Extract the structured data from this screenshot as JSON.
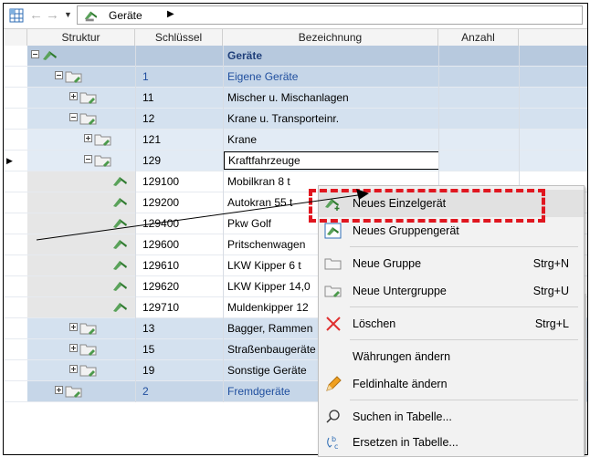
{
  "toolbar": {
    "grid_icon": "grid-icon",
    "back_icon": "arrow-left-icon",
    "forward_icon": "arrow-right-icon",
    "dropdown_icon": "triangle-down-icon",
    "breadcrumb": "Geräte",
    "breadcrumb_arrow": "▶",
    "back_glyph": "←",
    "forward_glyph": "→",
    "dropdown_glyph": "▼"
  },
  "columns": [
    "Struktur",
    "Schlüssel",
    "Bezeichnung",
    "Anzahl"
  ],
  "selected_row_indicator": "▶",
  "rows": [
    {
      "key": "",
      "name": "Geräte"
    },
    {
      "key": "1",
      "name": "Eigene Geräte"
    },
    {
      "key": "11",
      "name": "Mischer u. Mischanlagen"
    },
    {
      "key": "12",
      "name": "Krane u. Transporteinr."
    },
    {
      "key": "121",
      "name": "Krane"
    },
    {
      "key": "129",
      "name": "Kraftfahrzeuge"
    },
    {
      "key": "129100",
      "name": "Mobilkran 8 t"
    },
    {
      "key": "129200",
      "name": "Autokran 55 t"
    },
    {
      "key": "129400",
      "name": "Pkw Golf"
    },
    {
      "key": "129600",
      "name": "Pritschenwagen"
    },
    {
      "key": "129610",
      "name": "LKW Kipper 6 t"
    },
    {
      "key": "129620",
      "name": "LKW Kipper 14,0"
    },
    {
      "key": "129710",
      "name": "Muldenkipper 12"
    },
    {
      "key": "13",
      "name": "Bagger, Rammen"
    },
    {
      "key": "15",
      "name": "Straßenbaugeräte"
    },
    {
      "key": "19",
      "name": "Sonstige Geräte"
    },
    {
      "key": "2",
      "name": "Fremdgeräte"
    }
  ],
  "context_menu": {
    "items": [
      {
        "label": "Neues Einzelgerät",
        "shortcut": ""
      },
      {
        "label": "Neues Gruppengerät",
        "shortcut": ""
      },
      {
        "label": "Neue Gruppe",
        "shortcut": "Strg+N"
      },
      {
        "label": "Neue Untergruppe",
        "shortcut": "Strg+U"
      },
      {
        "label": "Löschen",
        "shortcut": "Strg+L"
      },
      {
        "label": "Währungen ändern",
        "shortcut": ""
      },
      {
        "label": "Feldinhalte ändern",
        "shortcut": ""
      },
      {
        "label": "Suchen in Tabelle...",
        "shortcut": ""
      },
      {
        "label": "Ersetzen in Tabelle...",
        "shortcut": ""
      }
    ]
  },
  "colors": {
    "highlight_dash": "#e0161f",
    "group_blue": "#1f4e9e",
    "tree_icon_green": "#3a8a3a"
  }
}
